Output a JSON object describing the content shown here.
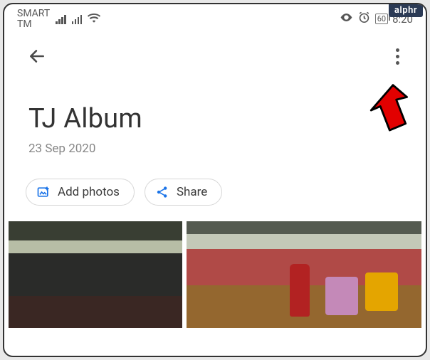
{
  "watermark": "alphr",
  "status": {
    "carrier_line1": "SMART",
    "carrier_line2": "TM",
    "battery_pct": "60",
    "clock": "8:20"
  },
  "album": {
    "title": "TJ Album",
    "date": "23 Sep 2020"
  },
  "actions": {
    "add_photos_label": "Add photos",
    "share_label": "Share"
  },
  "icons": {
    "back": "back-arrow-icon",
    "more": "more-vert-icon",
    "add_photos": "add-photo-icon",
    "share": "share-icon",
    "eye": "eye-icon",
    "alarm": "alarm-icon",
    "wifi": "wifi-icon",
    "signal": "cellular-signal-icon",
    "battery": "battery-icon"
  },
  "annotation": {
    "target": "more-options-button"
  }
}
